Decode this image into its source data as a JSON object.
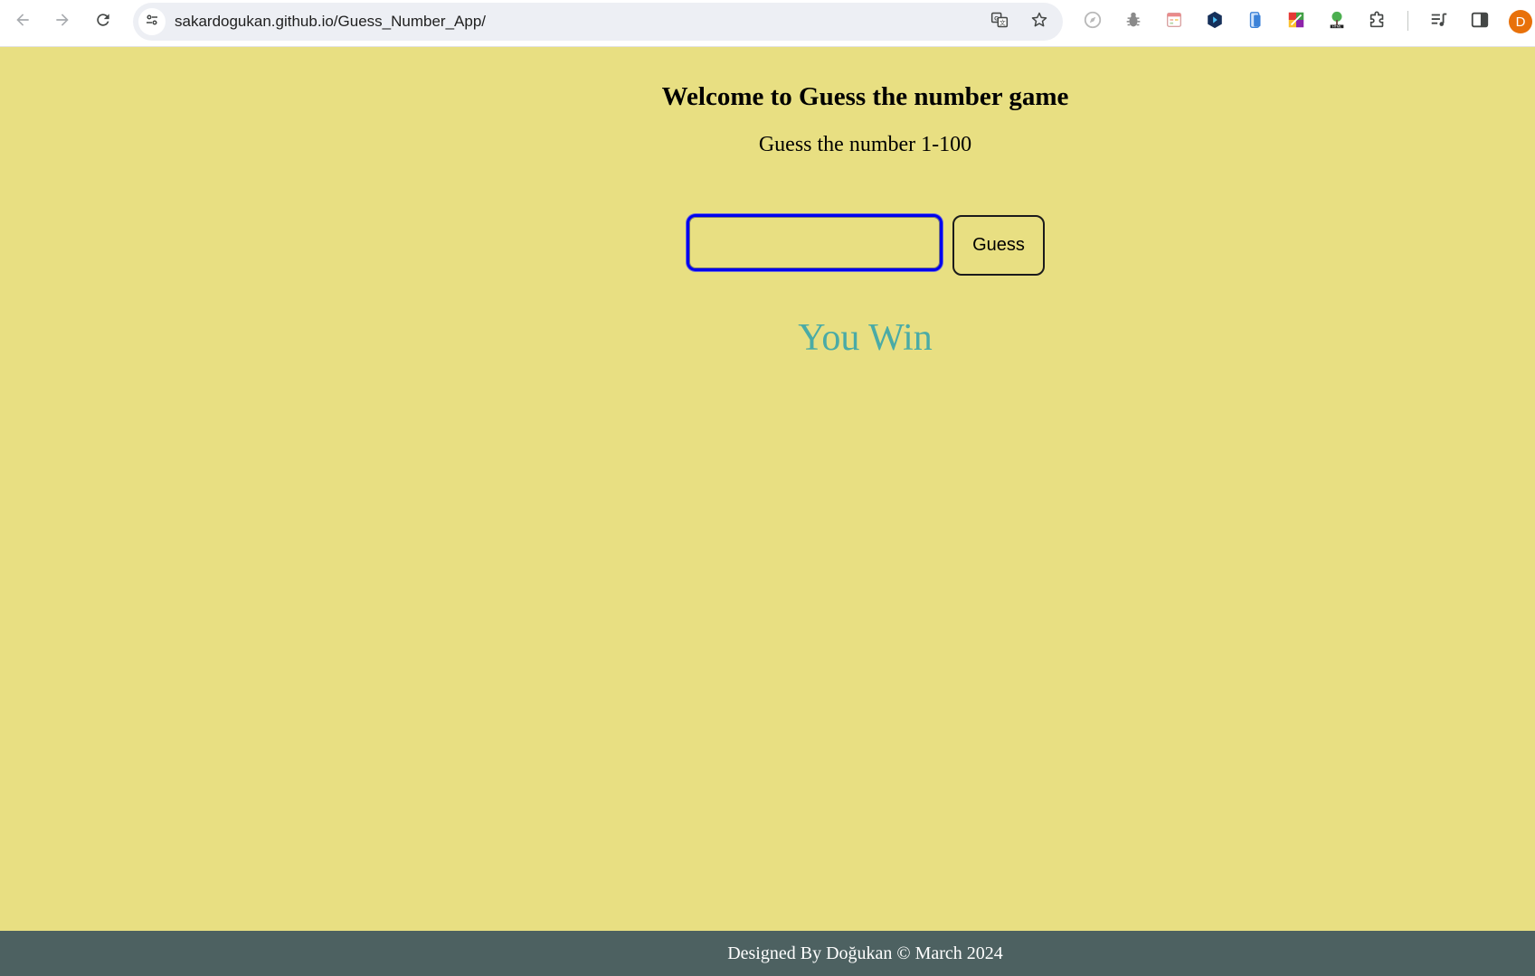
{
  "browser": {
    "url": "sakardogukan.github.io/Guess_Number_App/",
    "profile_initial": "D",
    "icons": {
      "back": "back-arrow-icon",
      "forward": "forward-arrow-icon",
      "reload": "reload-icon",
      "site_info": "tune-icon",
      "translate": "translate-icon",
      "bookmark": "star-icon",
      "side_panel": "side-panel-icon",
      "reading_list": "reading-list-icon",
      "extensions": "puzzle-icon"
    },
    "profile_color": "#e8710a"
  },
  "page": {
    "title": "Welcome to Guess the number game",
    "subtitle": "Guess the number 1-100",
    "guess_input_value": "",
    "guess_button_label": "Guess",
    "result_text": "You Win",
    "background_color": "#e8df82",
    "result_color": "#4aaba6"
  },
  "footer": {
    "text": "Designed By Doğukan © March 2024",
    "background_color": "#4d6161"
  }
}
